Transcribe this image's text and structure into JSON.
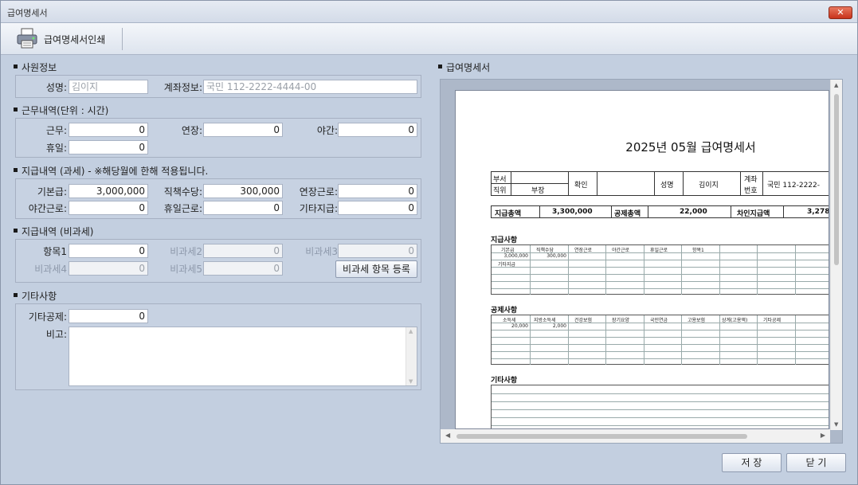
{
  "window": {
    "title": "급여명세서",
    "close_label": "✕"
  },
  "toolbar": {
    "print_label": "급여명세서인쇄"
  },
  "employee": {
    "section": "사원정보",
    "name_label": "성명:",
    "name_value": "김이지",
    "account_label": "계좌정보:",
    "account_value": "국민 112-2222-4444-00"
  },
  "work": {
    "section": "근무내역(단위 : 시간)",
    "work_label": "근무:",
    "work_value": "0",
    "overtime_label": "연장:",
    "overtime_value": "0",
    "night_label": "야간:",
    "night_value": "0",
    "holiday_label": "휴일:",
    "holiday_value": "0"
  },
  "taxable": {
    "section": "지급내역 (과세) - ※해당월에 한해 적용됩니다.",
    "base_label": "기본급:",
    "base_value": "3,000,000",
    "duty_label": "직책수당:",
    "duty_value": "300,000",
    "ot_label": "연장근로:",
    "ot_value": "0",
    "night_label": "야간근로:",
    "night_value": "0",
    "holiday_label": "휴일근로:",
    "holiday_value": "0",
    "other_label": "기타지급:",
    "other_value": "0"
  },
  "nontax": {
    "section": "지급내역 (비과세)",
    "item1_label": "항목1",
    "item1_value": "0",
    "item2_label": "비과세2",
    "item2_value": "0",
    "item3_label": "비과세3",
    "item3_value": "0",
    "item4_label": "비과세4",
    "item4_value": "0",
    "item5_label": "비과세5",
    "item5_value": "0",
    "register_button": "비과세 항목 등록"
  },
  "etc": {
    "section": "기타사항",
    "deduction_label": "기타공제:",
    "deduction_value": "0",
    "remark_label": "비고:"
  },
  "preview": {
    "section": "급여명세서",
    "doc_title": "2025년 05월 급여명세서",
    "dept_label": "부서",
    "position_label": "직위",
    "position_value": "부장",
    "confirm_label": "확인",
    "name_label": "성명",
    "name_value": "김이지",
    "bank_label_1": "계좌",
    "bank_label_2": "번호",
    "bank_value": "국민 112-2222-",
    "total_pay_label": "지급총액",
    "total_pay_value": "3,300,000",
    "total_ded_label": "공제총액",
    "total_ded_value": "22,000",
    "net_label": "차인지급액",
    "net_value": "3,278",
    "pay_section": "지급사항",
    "pay_headers": [
      "기본급",
      "직책수당",
      "연장근로",
      "야간근로",
      "휴일근로",
      "항목1"
    ],
    "pay_values": [
      "3,000,000",
      "300,000"
    ],
    "pay_extra": "기타지급",
    "ded_section": "공제사항",
    "ded_headers": [
      "소득세",
      "지방소득세",
      "건강보험",
      "장기요양",
      "국민연금",
      "고용보험",
      "상계(고용액)",
      "기타공제"
    ],
    "ded_values": [
      "20,000",
      "2,000"
    ],
    "etc_section": "기타사항"
  },
  "footer": {
    "save_label": "저 장",
    "close_label": "닫 기"
  }
}
